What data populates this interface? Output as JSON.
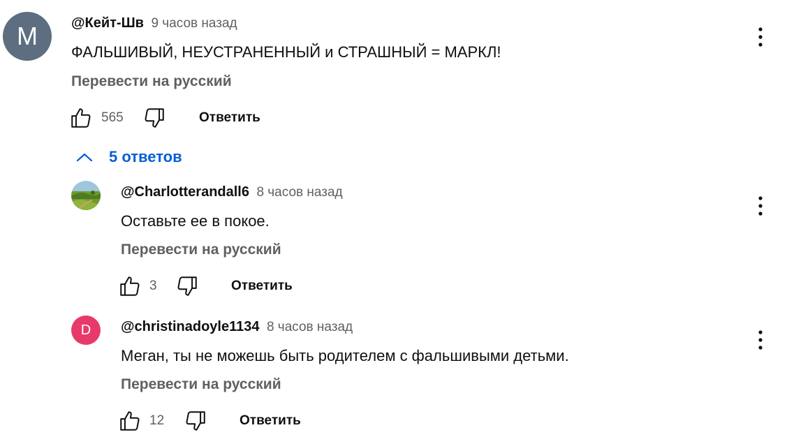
{
  "comments": [
    {
      "author": "@Кейт-Шв",
      "time": "9 часов назад",
      "text": "ФАЛЬШИВЫЙ, НЕУСТРАНЕННЫЙ и СТРАШНЫЙ = МАРКЛ!",
      "translate": "Перевести на русский",
      "likes": "565",
      "reply": "Ответить",
      "avatar_letter": "M",
      "avatar_color": "#5c6e80"
    }
  ],
  "replies_toggle": {
    "label": "5 ответов",
    "icon": "chevron-up-icon",
    "color": "#065fd4"
  },
  "replies": [
    {
      "author": "@Charlotterandall6",
      "time": "8 часов назад",
      "text": "Оставьте ее в покое.",
      "translate": "Перевести на русский",
      "likes": "3",
      "reply": "Ответить",
      "avatar": "landscape-photo"
    },
    {
      "author": "@christinadoyle1134",
      "time": "8 часов назад",
      "text": "Меган, ты не можешь быть родителем с фальшивыми детьми.",
      "translate": "Перевести на русский",
      "likes": "12",
      "reply": "Ответить",
      "avatar_letter": "D",
      "avatar_color": "#e8396b"
    }
  ]
}
